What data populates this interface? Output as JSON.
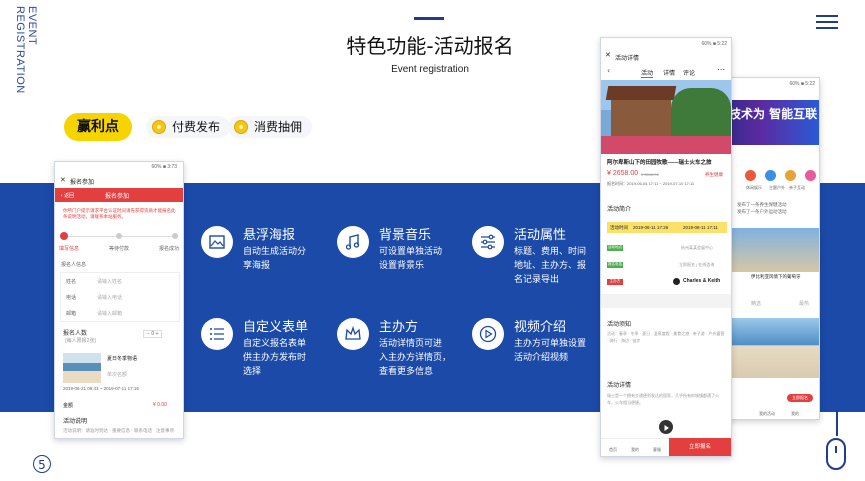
{
  "side_label": "EVENT REGISTRATION",
  "header": {
    "title": "特色功能-活动报名",
    "subtitle": "Event registration"
  },
  "benefits": {
    "main": "赢利点",
    "items": [
      "付费发布",
      "消费抽佣"
    ]
  },
  "features": [
    {
      "title": "悬浮海报",
      "desc_lines": [
        "自动生成活动分",
        "享海报"
      ],
      "icon": "image-icon"
    },
    {
      "title": "背景音乐",
      "desc_lines": [
        "可设置单独活动",
        "设置背景乐"
      ],
      "icon": "music-note-icon"
    },
    {
      "title": "活动属性",
      "desc_lines": [
        "标题、费用、时间",
        "地址、主办方、报",
        "名记录导出"
      ],
      "icon": "sliders-icon"
    },
    {
      "title": "自定义表单",
      "desc_lines": [
        "自定义报名表单",
        "供主办方发布时",
        "选择"
      ],
      "icon": "list-icon"
    },
    {
      "title": "主办方",
      "desc_lines": [
        "活动详情页可进",
        "入主办方详情页，",
        "查看更多信息"
      ],
      "icon": "crown-icon"
    },
    {
      "title": "视频介绍",
      "desc_lines": [
        "主办方可单独设置",
        "活动介绍视频"
      ],
      "icon": "play-icon"
    }
  ],
  "phone_left": {
    "status": "60% ■ 3:73",
    "nav_title": "报名参加",
    "back": "返回",
    "red_title": "报名参加",
    "notice": "你所门户提示请求平台认证时间请先获得资质才能报名此条说明活动，请联系本站服务。",
    "steps": [
      "填写信息",
      "等待付款",
      "报名成功"
    ],
    "section": "报名人信息",
    "fields": [
      {
        "label": "姓名",
        "placeholder": "请输入姓名"
      },
      {
        "label": "电话",
        "placeholder": "请输入电话"
      },
      {
        "label": "邮箱",
        "placeholder": "请输入邮箱"
      }
    ],
    "count_label": "报名人数",
    "count_sub": "(每人限报2张)",
    "count_value": "0",
    "event_name": "夏日冬季物语",
    "event_sub": "单次名额",
    "event_time": "2019-06-21 09:43 ~ 2019-07-11 17:16",
    "amount_label": "金额",
    "amount_value": "¥ 0.00",
    "desc_label": "活动说明",
    "desc_text": "活动说明：请准时到达 · 重要信息 · 联系电话 · 注意事项"
  },
  "phone_mid": {
    "status": "60% ■ 5:22",
    "nav_title": "活动详情",
    "tabs": [
      "活动",
      "详情",
      "评论"
    ],
    "event_title": "阿尔卑斯山下的田园牧歌——瑞士火车之旅",
    "price": "¥ 2658.00",
    "price_old": "¥ 3868.00",
    "price_tag": "养生健康",
    "time_line": "报名时间：2019-06-04 17:11 ~ 2019-07-10 17:11",
    "intro_label": "活动简介",
    "activity_time_label": "活动时间",
    "activity_time_start": "2019-06-11 17:26",
    "activity_time_end": "2019-08-11 17:11",
    "addr_tag": "活动地点",
    "addr_text": "杭州某某会展中心",
    "contact_tag": "报名电话",
    "contact_text": "立即报名 | 在线咨询",
    "org_tag": "主办方",
    "org_name": "Charles & Keith",
    "notice_label": "活动须知",
    "notice_text": "活动：春季 · 冬季 · 夏日 · 温泉度假 · 美食之旅 · 亲子游 · 户外露营 · 骑行 · 海边 · 徒步",
    "detail_label": "活动详情",
    "detail_text": "瑞士是一个拥有交通便利发达的国家，几乎所有的城镇都通了火车，火车相当便捷。",
    "bottom_nav": [
      "首页",
      "我的",
      "客服"
    ],
    "cta": "立即报名"
  },
  "phone_right": {
    "status": "60% ■ 5:22",
    "banner_text": "技术为 智能互联",
    "icons": [
      "活动",
      "休闲娱乐",
      "主题户外",
      "亲子互动"
    ],
    "news": [
      "发布了一条养生保健活动",
      "发布了一条户外运动活动"
    ],
    "section_left": "精选",
    "section_right": "最热",
    "card_title": "伊比利亚风情下的葡萄牙",
    "price": "¥ 168",
    "cta": "立即报名",
    "bottom_nav": [
      "首页",
      "我的活动",
      "我的"
    ]
  },
  "page_number": "5",
  "colors": {
    "brand_blue": "#1b4aa8",
    "accent_yellow": "#f5d400",
    "red": "#e43f3f"
  }
}
